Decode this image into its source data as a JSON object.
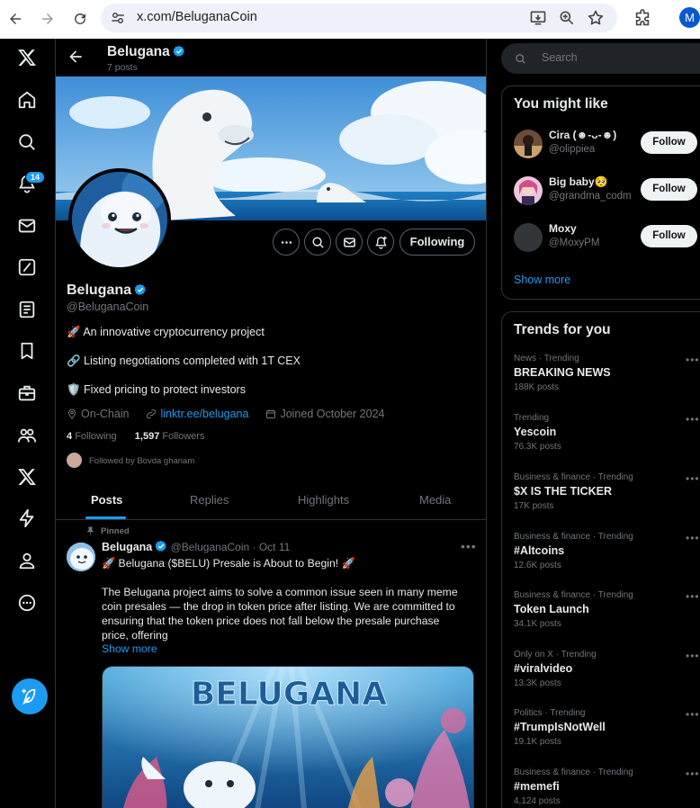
{
  "browser": {
    "url": "x.com/BeluganaCoin",
    "profile_initial": "M"
  },
  "nav": {
    "notification_count": "14",
    "items": [
      "x-logo",
      "home",
      "explore",
      "notifications",
      "messages",
      "grok",
      "lists",
      "bookmarks",
      "jobs",
      "communities",
      "premium",
      "verified-orgs",
      "profile",
      "more"
    ]
  },
  "header": {
    "name": "Belugana",
    "post_count": "7 posts"
  },
  "profile": {
    "name": "Belugana",
    "handle": "@BeluganaCoin",
    "bio_lines": [
      "🚀 An innovative cryptocurrency project",
      "🔗 Listing negotiations completed with 1T CEX",
      "🛡️ Fixed pricing to protect investors"
    ],
    "location": "On-Chain",
    "link": "linktr.ee/belugana",
    "joined": "Joined October 2024",
    "following_count": "4",
    "following_label": "Following",
    "followers_count": "1,597",
    "followers_label": "Followers",
    "followed_by": "Followed by Bovda ghanam",
    "following_button": "Following"
  },
  "tabs": [
    "Posts",
    "Replies",
    "Highlights",
    "Media"
  ],
  "pinned_post": {
    "pinned_label": "Pinned",
    "author": "Belugana",
    "handle_date": "@BeluganaCoin · Oct 11",
    "title": "🚀 Belugana ($BELU) Presale is About to Begin! 🚀",
    "body_lines": [
      "The Belugana project aims to solve a common issue seen in many meme",
      "coin presales — the drop in token price after listing. We are committed to",
      "ensuring that the token price does not fall below the presale purchase",
      "price, offering"
    ],
    "show_more": "Show more",
    "media_text": "BELUGANA"
  },
  "sidebar": {
    "search_placeholder": "Search",
    "you_might_like_title": "You might like",
    "suggestions": [
      {
        "name": "Cira (☻-ᴗ-☻)",
        "handle": "@olippiea",
        "button": "Follow"
      },
      {
        "name": "Big baby🥺",
        "handle": "@grandma_codm",
        "button": "Follow"
      },
      {
        "name": "Moxy",
        "handle": "@MoxyPM",
        "button": "Follow"
      }
    ],
    "show_more": "Show more",
    "trends_title": "Trends for you",
    "trends": [
      {
        "category": "News · Trending",
        "title": "BREAKING NEWS",
        "posts": "188K posts"
      },
      {
        "category": "Trending",
        "title": "Yescoin",
        "posts": "76.3K posts"
      },
      {
        "category": "Business & finance · Trending",
        "title": "$X IS THE TICKER",
        "posts": "17K posts"
      },
      {
        "category": "Business & finance · Trending",
        "title": "#Altcoins",
        "posts": "12.6K posts"
      },
      {
        "category": "Business & finance · Trending",
        "title": "Token Launch",
        "posts": "34.1K posts"
      },
      {
        "category": "Only on X · Trending",
        "title": "#viralvideo",
        "posts": "13.3K posts"
      },
      {
        "category": "Politics · Trending",
        "title": "#TrumpIsNotWell",
        "posts": "19.1K posts"
      },
      {
        "category": "Business & finance · Trending",
        "title": "#memefi",
        "posts": "4,124 posts"
      }
    ]
  },
  "colors": {
    "accent": "#1d9bf0",
    "background": "#000000",
    "border": "#2f3336",
    "muted_text": "#71767b"
  }
}
